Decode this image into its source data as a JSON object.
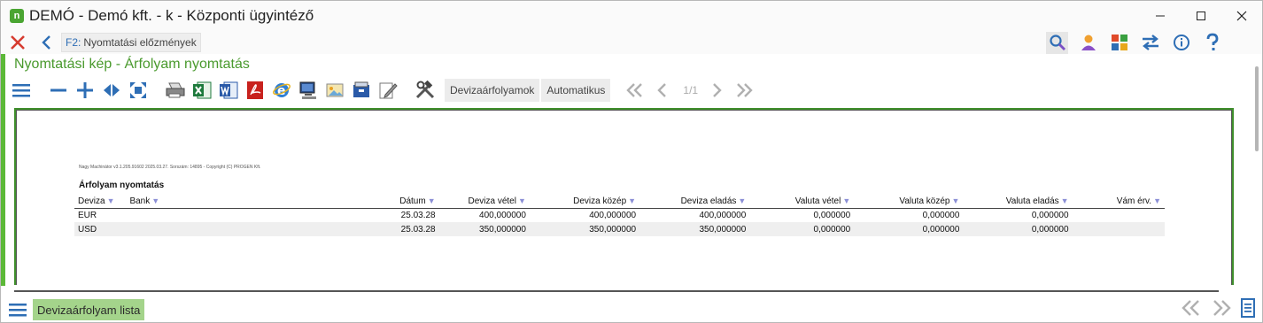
{
  "window": {
    "title": "DEMÓ - Demó kft. - k - Központi ügyintéző",
    "app_icon_letter": "n"
  },
  "nav": {
    "f2_key": "F2:",
    "f2_label": "Nyomtatási előzmények"
  },
  "panel": {
    "title": "Nyomtatási kép - Árfolyam nyomtatás"
  },
  "toolbar": {
    "btn_exchange": "Devizaárfolyamok",
    "btn_auto": "Automatikus",
    "page_indicator": "1/1"
  },
  "report": {
    "meta_line": "Nagy Machinátor v3.1.205.91602 2025.03.27. Sorszám: 14895 - Copyright (C) PROGEN Kft.",
    "title": "Árfolyam nyomtatás",
    "filter_glyph": "▼",
    "columns": [
      "Deviza",
      "Bank",
      "Dátum",
      "Deviza vétel",
      "Deviza közép",
      "Deviza eladás",
      "Valuta vétel",
      "Valuta közép",
      "Valuta eladás",
      "Vám érv."
    ],
    "rows": [
      {
        "deviza": "EUR",
        "bank": "",
        "datum": "25.03.28",
        "deviza_vetel": "400,000000",
        "deviza_kozep": "400,000000",
        "deviza_eladas": "400,000000",
        "valuta_vetel": "0,000000",
        "valuta_kozep": "0,000000",
        "valuta_eladas": "0,000000",
        "vam_erv": ""
      },
      {
        "deviza": "USD",
        "bank": "",
        "datum": "25.03.28",
        "deviza_vetel": "350,000000",
        "deviza_kozep": "350,000000",
        "deviza_eladas": "350,000000",
        "valuta_vetel": "0,000000",
        "valuta_kozep": "0,000000",
        "valuta_eladas": "0,000000",
        "vam_erv": ""
      }
    ]
  },
  "bottom": {
    "tab_label": "Devizaárfolyam lista"
  },
  "colors": {
    "accent_green": "#5cb838",
    "title_green": "#4a9a2e",
    "tab_green": "#a4d48b",
    "icon_blue": "#2e6eb5",
    "close_red": "#d63b2f"
  }
}
